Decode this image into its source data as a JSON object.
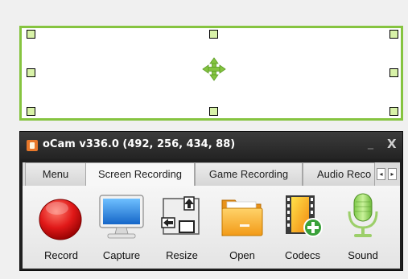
{
  "window": {
    "title": "oCam v336.0 (492, 256, 434, 88)",
    "minimize_glyph": "_",
    "close_glyph": "X"
  },
  "tabs": [
    {
      "label": "Menu",
      "active": false
    },
    {
      "label": "Screen Recording",
      "active": true
    },
    {
      "label": "Game Recording",
      "active": false
    },
    {
      "label": "Audio Reco",
      "active": false
    }
  ],
  "tab_scroll": {
    "left_glyph": "◂",
    "right_glyph": "▸"
  },
  "toolbar": {
    "record_label": "Record",
    "capture_label": "Capture",
    "resize_label": "Resize",
    "open_label": "Open",
    "codecs_label": "Codecs",
    "sound_label": "Sound"
  },
  "icons": {
    "record": "record-icon",
    "capture": "monitor-icon",
    "resize": "resize-icon",
    "open": "folder-icon",
    "codecs": "film-add-icon",
    "sound": "microphone-icon",
    "move": "move-arrows-icon"
  },
  "colors": {
    "region_border": "#86c440",
    "region_handle": "#d8f2a8",
    "titlebar": "#2b2b2b",
    "record_red": "#e01818",
    "move_green": "#84c440"
  }
}
